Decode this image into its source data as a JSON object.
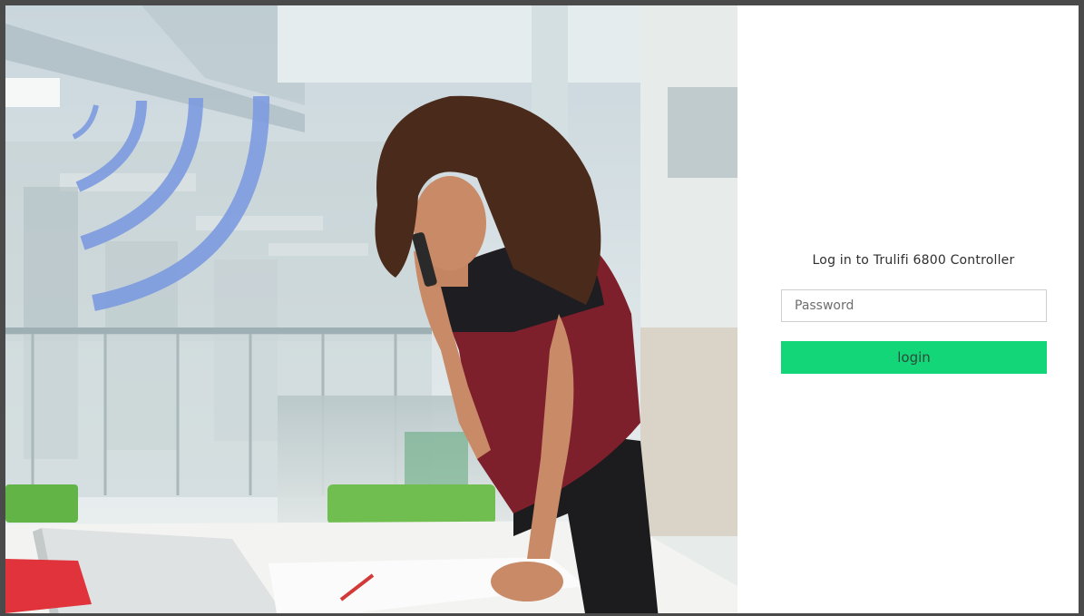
{
  "login": {
    "title": "Log in to Trulifi 6800 Controller",
    "password_placeholder": "Password",
    "button_label": "login",
    "button_color": "#12d677"
  },
  "hero": {
    "icon": "light-wave-icon",
    "image_subject": "woman-on-phone-at-desk"
  }
}
